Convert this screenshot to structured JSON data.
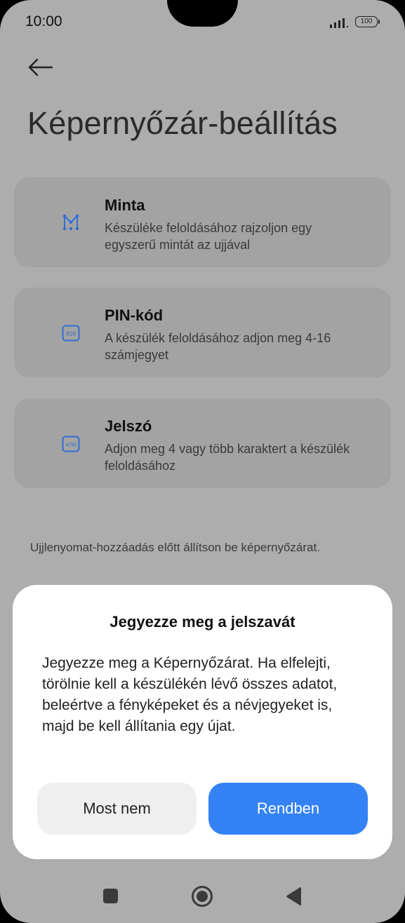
{
  "status_bar": {
    "time": "10:00",
    "battery": "100"
  },
  "page": {
    "title": "Képernyőzár-beállítás"
  },
  "options": [
    {
      "icon": "pattern-icon",
      "title": "Minta",
      "description": "Készüléke feloldásához rajzoljon egy egyszerű mintát az ujjával"
    },
    {
      "icon": "pin-icon",
      "icon_text": "816",
      "title": "PIN-kód",
      "description": "A készülék feloldásához adjon meg 4-16 számjegyet"
    },
    {
      "icon": "password-icon",
      "icon_text": "#7M",
      "title": "Jelszó",
      "description": "Adjon meg 4 vagy több karaktert a készülék feloldásához"
    }
  ],
  "hint": "Ujjlenyomat-hozzáadás előtt állítson be képernyőzárat.",
  "dialog": {
    "title": "Jegyezze meg a jelszavát",
    "body": "Jegyezze meg a Képernyőzárat. Ha elfelejti, törölnie kell a készülékén lévő összes adatot, beleértve a fényképeket és a névjegyeket is, majd be kell állítania egy újat.",
    "cancel_label": "Most nem",
    "ok_label": "Rendben"
  },
  "colors": {
    "accent": "#3482f6",
    "icon_blue": "#2f6fd6",
    "scrim": "#adadad"
  }
}
